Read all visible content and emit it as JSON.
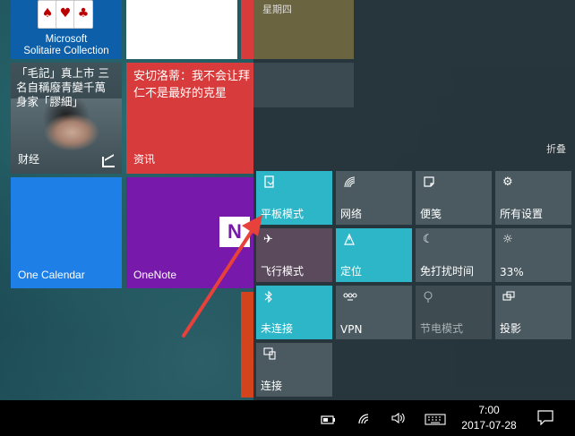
{
  "start_tiles": {
    "solitaire": {
      "title_line1": "Microsoft",
      "title_line2": "Solitaire Collection"
    },
    "news": {
      "headline": "「毛記」真上市 三名自稱廢青變千萬身家「膠細」",
      "label": "财经"
    },
    "info": {
      "headline": "安切洛蒂：我不会让拜仁不是最好的克星",
      "label": "资讯"
    },
    "calendar": {
      "label": "One Calendar"
    },
    "onenote": {
      "label": "OneNote"
    }
  },
  "action_center": {
    "day": "星期四",
    "collapse_label": "折叠",
    "quick_actions": [
      {
        "label": "平板模式",
        "icon": "tablet-mode-icon",
        "state": "on"
      },
      {
        "label": "网络",
        "icon": "network-icon",
        "state": "off"
      },
      {
        "label": "便笺",
        "icon": "note-icon",
        "state": "off"
      },
      {
        "label": "所有设置",
        "icon": "gear-icon",
        "state": "off"
      },
      {
        "label": "飞行模式",
        "icon": "airplane-icon",
        "state": "off"
      },
      {
        "label": "定位",
        "icon": "location-icon",
        "state": "on"
      },
      {
        "label": "免打扰时间",
        "icon": "moon-icon",
        "state": "off"
      },
      {
        "label": "33%",
        "icon": "brightness-icon",
        "state": "off"
      },
      {
        "label": "未连接",
        "icon": "bluetooth-icon",
        "state": "on"
      },
      {
        "label": "VPN",
        "icon": "vpn-icon",
        "state": "off"
      },
      {
        "label": "节电模式",
        "icon": "battery-saver-icon",
        "state": "disabled"
      },
      {
        "label": "投影",
        "icon": "project-icon",
        "state": "off"
      },
      {
        "label": "连接",
        "icon": "connect-icon",
        "state": "off"
      }
    ]
  },
  "taskbar": {
    "time": "7:00",
    "date": "2017-07-28"
  },
  "colors": {
    "accent": "#2cb6c8",
    "annotation_arrow": "#e8403a"
  }
}
